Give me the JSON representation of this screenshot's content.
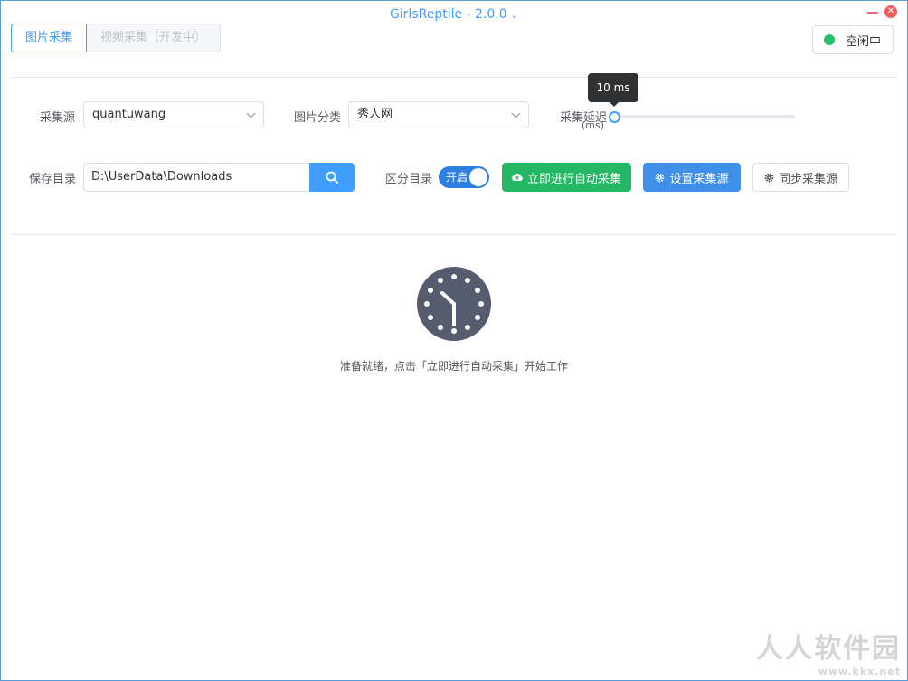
{
  "window": {
    "title": "GirlsReptile - 2.0.0"
  },
  "tabs": [
    {
      "label": "图片采集"
    },
    {
      "label": "视频采集（开发中）"
    }
  ],
  "status": {
    "label": "空闲中",
    "color": "#27c06b"
  },
  "form": {
    "source_label": "采集源",
    "source_value": "quantuwang",
    "category_label": "图片分类",
    "category_value": "秀人网",
    "delay_label": "采集延迟",
    "delay_unit": "(ms)",
    "delay_tooltip": "10 ms",
    "delay_value": 10,
    "dir_label": "保存目录",
    "dir_value": "D:\\UserData\\Downloads",
    "split_label": "区分目录",
    "split_switch_text": "开启",
    "split_on": true
  },
  "buttons": {
    "start": "立即进行自动采集",
    "config": "设置采集源",
    "sync": "同步采集源"
  },
  "main": {
    "ready_text": "准备就绪，点击「立即进行自动采集」开始工作"
  },
  "watermark": {
    "line1": "人人软件园",
    "line2": "www.kkx.net"
  },
  "colors": {
    "accent": "#409eff",
    "success": "#25b864",
    "clock": "#555c6e"
  }
}
